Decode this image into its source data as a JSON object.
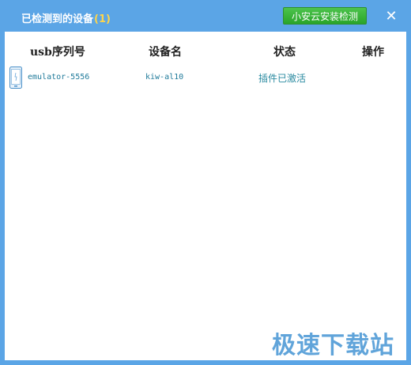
{
  "window": {
    "title": "已检测到的设备",
    "count": "(1)",
    "detect_button_label": "小安云安装检测",
    "close_glyph": "✕"
  },
  "table": {
    "headers": [
      "usb序列号",
      "设备名",
      "状态",
      "操作"
    ],
    "rows": [
      {
        "icon": "phone-icon",
        "serial": "emulator-5556",
        "device_name": "kiw-al10",
        "status": "插件已激活",
        "action": ""
      }
    ]
  },
  "watermark": "极速下载站",
  "colors": {
    "title_bar": "#5ba5e6",
    "count": "#ffd54a",
    "button_green": "#2aa52a",
    "row_text": "#1f7a9a",
    "watermark": "#4f9bd6"
  }
}
